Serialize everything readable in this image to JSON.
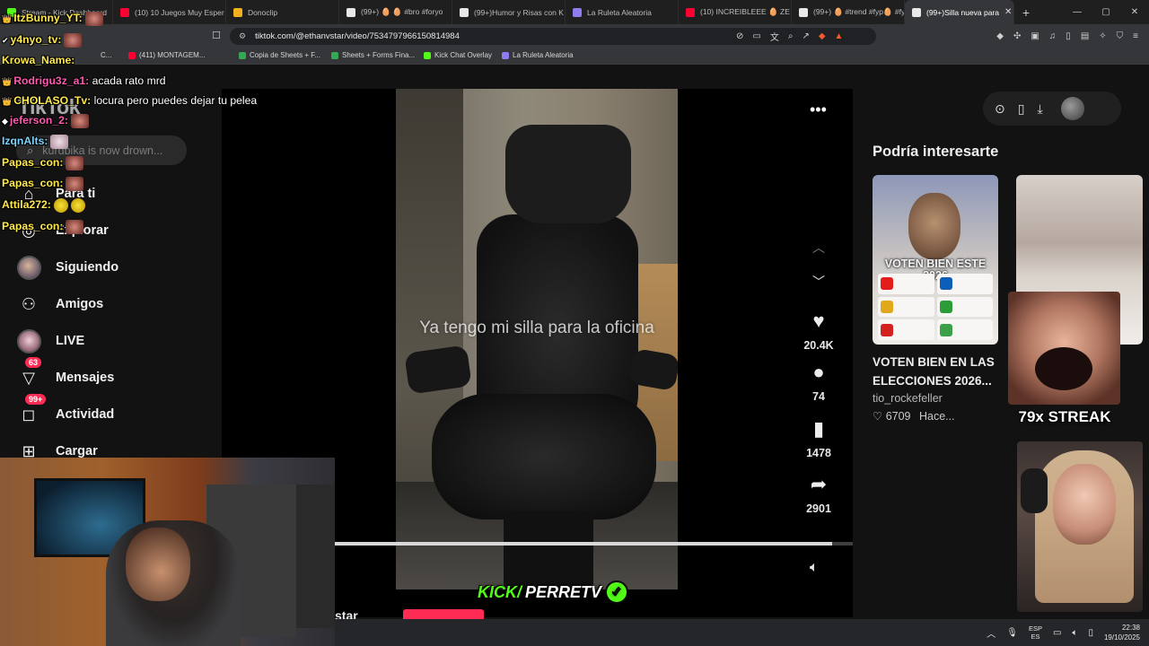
{
  "browser": {
    "tabs": [
      {
        "label": "Stream - Kick Dashboard",
        "color": "#53fc18"
      },
      {
        "label": "(10) 10 Juegos Muy Esper",
        "color": "#ff0033"
      },
      {
        "label": "Donoclip",
        "color": "#f2b01e"
      },
      {
        "label": "(99+) 🥚 🥚 #bro #foryo",
        "color": "#ffffff"
      },
      {
        "label": "(99+)Humor y Risas con K",
        "color": "#ffffff"
      },
      {
        "label": "La Ruleta Aleatoria",
        "color": "#8f7cf0"
      },
      {
        "label": "(10) INCREIBLEEE 🥚 ZE",
        "color": "#ff0033"
      },
      {
        "label": "(99+) 🥚 #trend #fyp🥚 #fy",
        "color": "#ffffff"
      },
      {
        "label": "(99+)Silla nueva para",
        "color": "#ffffff",
        "active": true
      }
    ],
    "new_tab": "+",
    "window_controls": [
      "—",
      "▢",
      "✕"
    ],
    "url": "tiktok.com/@ethanvstar/video/7534797966150814984",
    "bookmarks": [
      {
        "label": "(411) MONTAGEM...",
        "color": "#ff0033"
      },
      {
        "label": "Copia de Sheets + F...",
        "color": "#34a853"
      },
      {
        "label": "Sheets + Forms Fina...",
        "color": "#34a853"
      },
      {
        "label": "Kick Chat Overlay",
        "color": "#53fc18"
      },
      {
        "label": "La Ruleta Aleatoria",
        "color": "#8f7cf0"
      }
    ],
    "bookmark_partial": "C..."
  },
  "tiktok": {
    "logo": "TikTok",
    "search_placeholder": "kurdbika is now drown...",
    "nav": [
      {
        "label": "Para ti",
        "icon": "home-icon"
      },
      {
        "label": "Explorar",
        "icon": "compass-icon"
      },
      {
        "label": "Siguiendo",
        "icon": "following-avatar"
      },
      {
        "label": "Amigos",
        "icon": "friends-icon"
      },
      {
        "label": "LIVE",
        "icon": "live-icon"
      },
      {
        "label": "Mensajes",
        "icon": "messages-icon",
        "badge": "63"
      },
      {
        "label": "Actividad",
        "icon": "activity-icon",
        "badge": "99+"
      },
      {
        "label": "Cargar",
        "icon": "upload-icon"
      }
    ],
    "video": {
      "caption": "Ya tengo mi silla para la oficina",
      "likes": "20.4K",
      "comments": "74",
      "saves": "1478",
      "shares": "2901",
      "progress": 0.96,
      "creator_partial": "star"
    },
    "recommendations": {
      "title": "Podría interesarte",
      "item1": {
        "overlay": "VOTEN BIEN ESTE 2026",
        "title": "VOTEN BIEN EN LAS ELECCIONES 2026...",
        "author": "tio_rockefeller",
        "likes": "6709",
        "time": "Hace..."
      }
    }
  },
  "stream_overlay": {
    "chat": [
      {
        "user": "ItzBunny_YT:",
        "color": "#ffe94d",
        "text": "",
        "emote": "face"
      },
      {
        "user": "y4nyo_tv:",
        "color": "#ffe94d",
        "text": "",
        "emote": "face"
      },
      {
        "user": "Krowa_Name:",
        "color": "#ffe94d",
        "text": "",
        "emote": ""
      },
      {
        "user": "Rodrigu3z_a1:",
        "color": "#ff5ab0",
        "text": "acada rato mrd",
        "emote": ""
      },
      {
        "user": "CHOLASO_Tv:",
        "color": "#ffe94d",
        "text": "locura pero puedes dejar tu pelea",
        "emote": ""
      },
      {
        "user": "jeferson_2:",
        "color": "#ff5ab0",
        "text": "",
        "emote": "face"
      },
      {
        "user": "IzqnAlts:",
        "color": "#7fd4ff",
        "text": "",
        "emote": "white"
      },
      {
        "user": "Papas_con:",
        "color": "#ffe94d",
        "text": "",
        "emote": "face"
      },
      {
        "user": "Papas_con:",
        "color": "#ffe94d",
        "text": "",
        "emote": "face"
      },
      {
        "user": "Attila272:",
        "color": "#ffe94d",
        "text": "",
        "emote": "yellow"
      },
      {
        "user": "Papas_con:",
        "color": "#ffe94d",
        "text": "",
        "emote": "face"
      }
    ],
    "streak": "79x STREAK",
    "kick_brand": "KICK/",
    "kick_channel": "PERRETV"
  },
  "taskbar": {
    "lang_top": "ESP",
    "lang_bottom": "ES",
    "time": "22:38",
    "date": "19/10/2025"
  }
}
